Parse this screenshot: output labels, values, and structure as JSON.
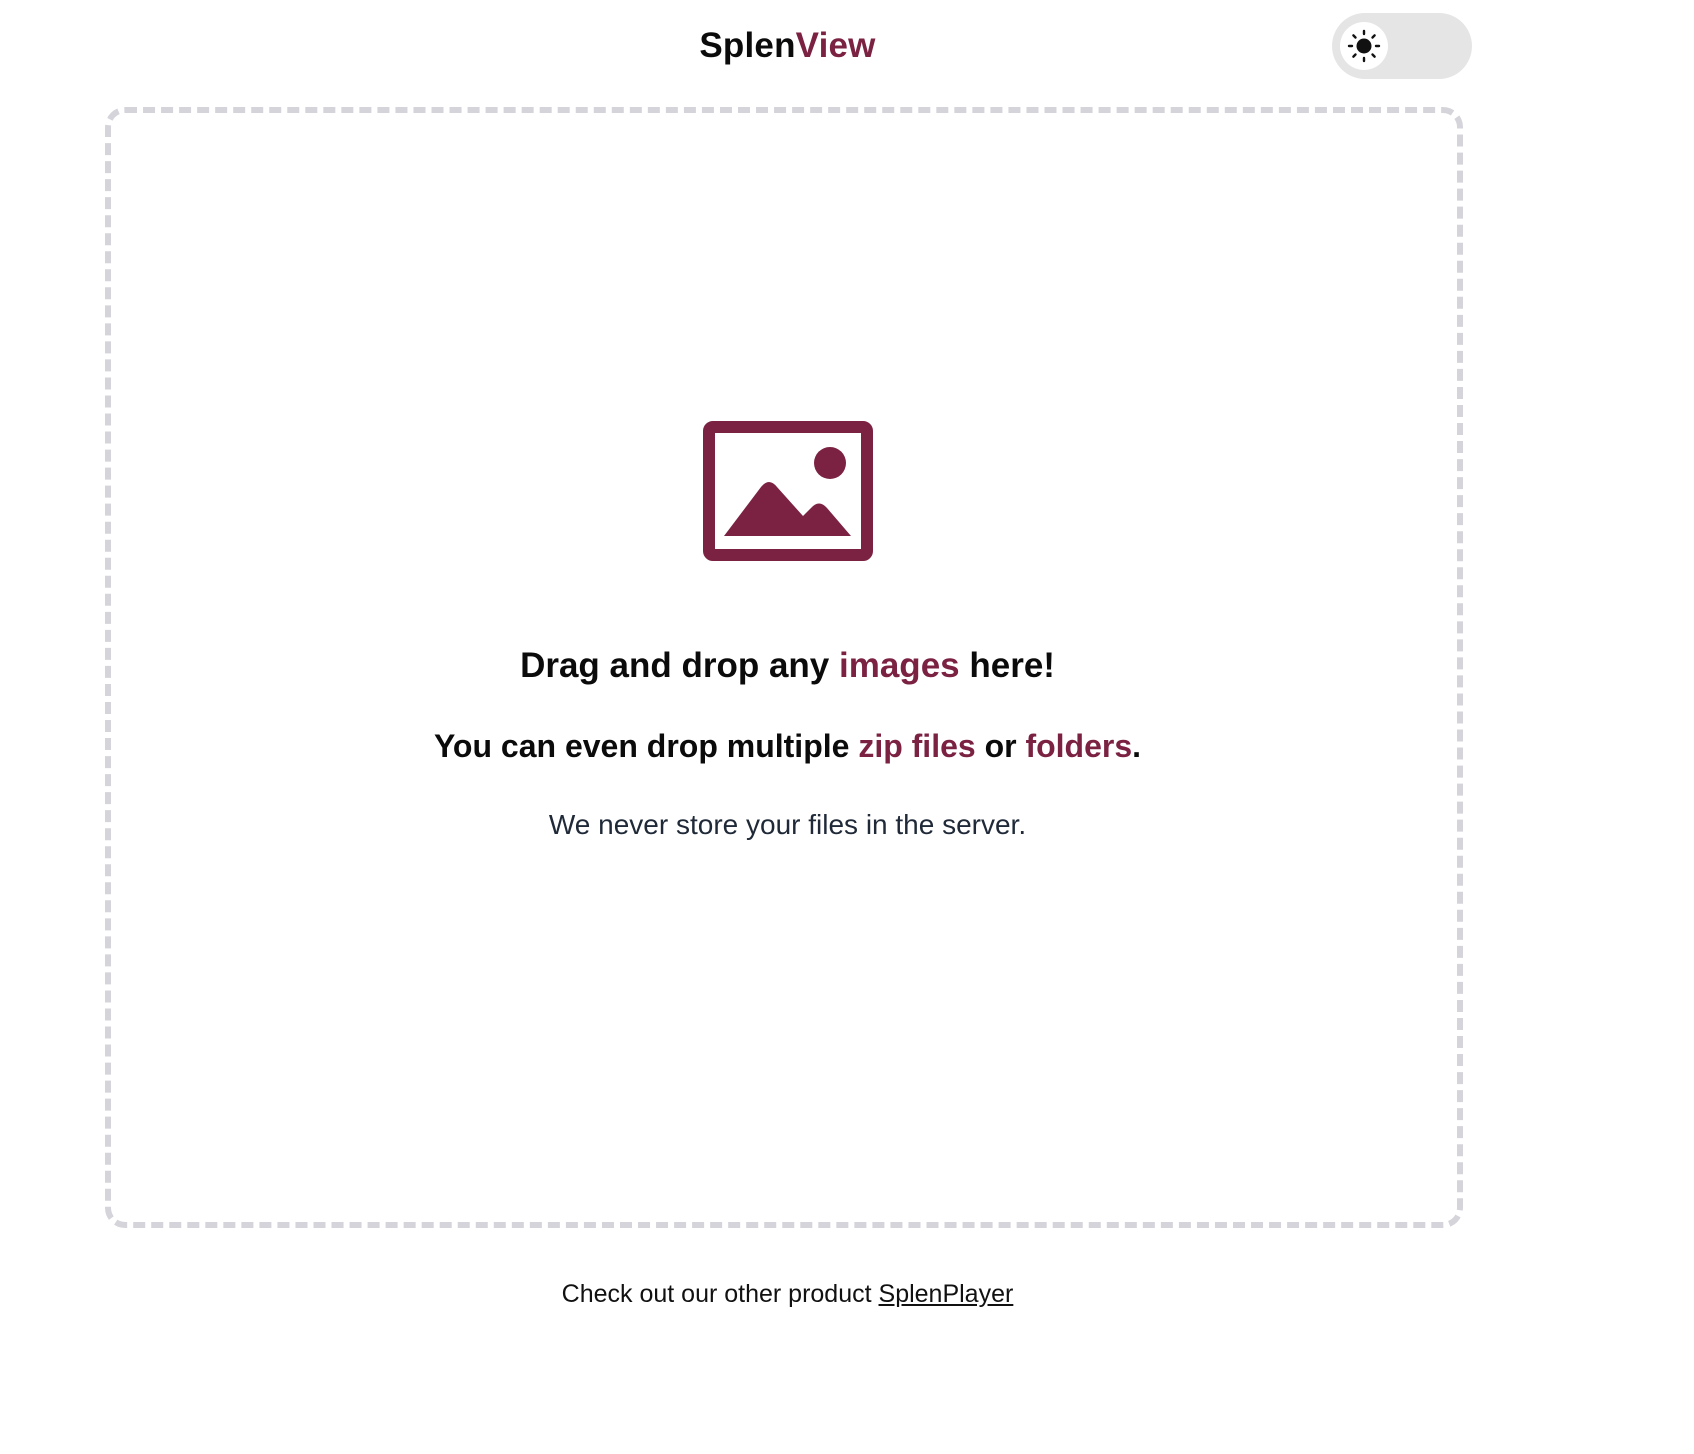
{
  "header": {
    "brand_part1": "Splen",
    "brand_part2": "View"
  },
  "theme_toggle": {
    "icon": "sun-icon",
    "state": "light"
  },
  "dropzone": {
    "icon": "image-icon",
    "line1": {
      "pre": "Drag and drop any ",
      "accent": "images",
      "post": " here!"
    },
    "line2": {
      "pre": "You can even drop multiple ",
      "accent1": "zip files",
      "mid": " or ",
      "accent2": "folders",
      "post": "."
    },
    "line3": "We never store your files in the server."
  },
  "footer": {
    "text": "Check out our other product ",
    "link": "SplenPlayer"
  },
  "colors": {
    "accent": "#7b2242",
    "border": "#d4d4da",
    "toggle_bg": "#e5e5e6"
  }
}
